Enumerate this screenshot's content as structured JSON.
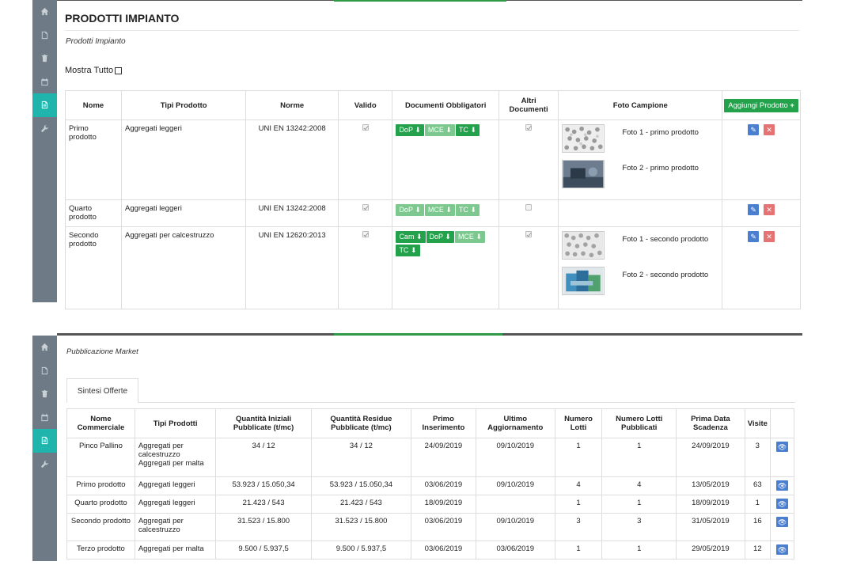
{
  "sidebar": {
    "items": [
      {
        "icon": "home-icon",
        "active": false
      },
      {
        "icon": "document-icon",
        "active": false
      },
      {
        "icon": "trash-icon",
        "active": false
      },
      {
        "icon": "calendar-icon",
        "active": false
      },
      {
        "icon": "file-text-icon",
        "active": true
      },
      {
        "icon": "wrench-icon",
        "active": false
      }
    ]
  },
  "prodotti": {
    "title": "PRODOTTI IMPIANTO",
    "breadcrumb": "Prodotti Impianto",
    "mostra_tutto": "Mostra Tutto",
    "headers": {
      "nome": "Nome",
      "tipi": "Tipi Prodotto",
      "norme": "Norme",
      "valido": "Valido",
      "documenti": "Documenti Obbligatori",
      "altri": "Altri Documenti",
      "foto": "Foto Campione",
      "add": "Aggiungi Prodotto"
    },
    "rows": [
      {
        "nome": "Primo prodotto",
        "tipo": "Aggregati leggeri",
        "norme": "UNI EN 13242:2008",
        "docs": [
          "DoP",
          "MCE",
          "TC"
        ],
        "foto1": "Foto 1 - primo prodotto",
        "foto2": "Foto 2 - primo prodotto"
      },
      {
        "nome": "Quarto prodotto",
        "tipo": "Aggregati leggeri",
        "norme": "UNI EN 13242:2008",
        "docs": [
          "DoP",
          "MCE",
          "TC"
        ]
      },
      {
        "nome": "Secondo prodotto",
        "tipo": "Aggregati per calcestruzzo",
        "norme": "UNI EN 12620:2013",
        "docs": [
          "Cam",
          "DoP",
          "MCE",
          "TC"
        ],
        "foto1": "Foto 1 - secondo prodotto",
        "foto2": "Foto 2 - secondo prodotto"
      }
    ]
  },
  "market": {
    "breadcrumb": "Pubblicazione Market",
    "tab": "Sintesi Offerte",
    "headers": {
      "nome": "Nome Commerciale",
      "tipi": "Tipi Prodotti",
      "qi": "Quantità Iniziali Pubblicate (t/mc)",
      "qr": "Quantità Residue Pubblicate (t/mc)",
      "primo": "Primo Inserimento",
      "ultimo": "Ultimo Aggiornamento",
      "lotti": "Numero Lotti",
      "lottipub": "Numero Lotti Pubblicati",
      "scad": "Prima Data Scadenza",
      "visite": "Visite"
    },
    "rows": [
      {
        "nome": "Pinco Pallino",
        "tipi": "Aggregati per calcestruzzo Aggregati per malta",
        "qi": "34 / 12",
        "qr": "34 / 12",
        "primo": "24/09/2019",
        "ultimo": "09/10/2019",
        "lotti": "1",
        "lottipub": "1",
        "scad": "24/09/2019",
        "visite": "3"
      },
      {
        "nome": "Primo prodotto",
        "tipi": "Aggregati leggeri",
        "qi": "53.923 / 15.050,34",
        "qr": "53.923 / 15.050,34",
        "primo": "03/06/2019",
        "ultimo": "09/10/2019",
        "lotti": "4",
        "lottipub": "4",
        "scad": "13/05/2019",
        "visite": "63"
      },
      {
        "nome": "Quarto prodotto",
        "tipi": "Aggregati leggeri",
        "qi": "21.423 / 543",
        "qr": "21.423 / 543",
        "primo": "18/09/2019",
        "ultimo": "",
        "lotti": "1",
        "lottipub": "1",
        "scad": "18/09/2019",
        "visite": "1"
      },
      {
        "nome": "Secondo prodotto",
        "tipi": "Aggregati per calcestruzzo",
        "qi": "31.523 / 15.800",
        "qr": "31.523 / 15.800",
        "primo": "03/06/2019",
        "ultimo": "09/10/2019",
        "lotti": "3",
        "lottipub": "3",
        "scad": "31/05/2019",
        "visite": "16"
      },
      {
        "nome": "Terzo prodotto",
        "tipi": "Aggregati per malta",
        "qi": "9.500 / 5.937,5",
        "qr": "9.500 / 5.937,5",
        "primo": "03/06/2019",
        "ultimo": "03/06/2019",
        "lotti": "1",
        "lottipub": "1",
        "scad": "29/05/2019",
        "visite": "12"
      }
    ]
  },
  "colors": {
    "sidebar": "#6e7b87",
    "sidebar_active": "#1fb5ac",
    "green": "#23a14b",
    "green_light": "#7cc88f",
    "edit_blue": "#4a7fd0",
    "delete_red": "#e57373"
  }
}
